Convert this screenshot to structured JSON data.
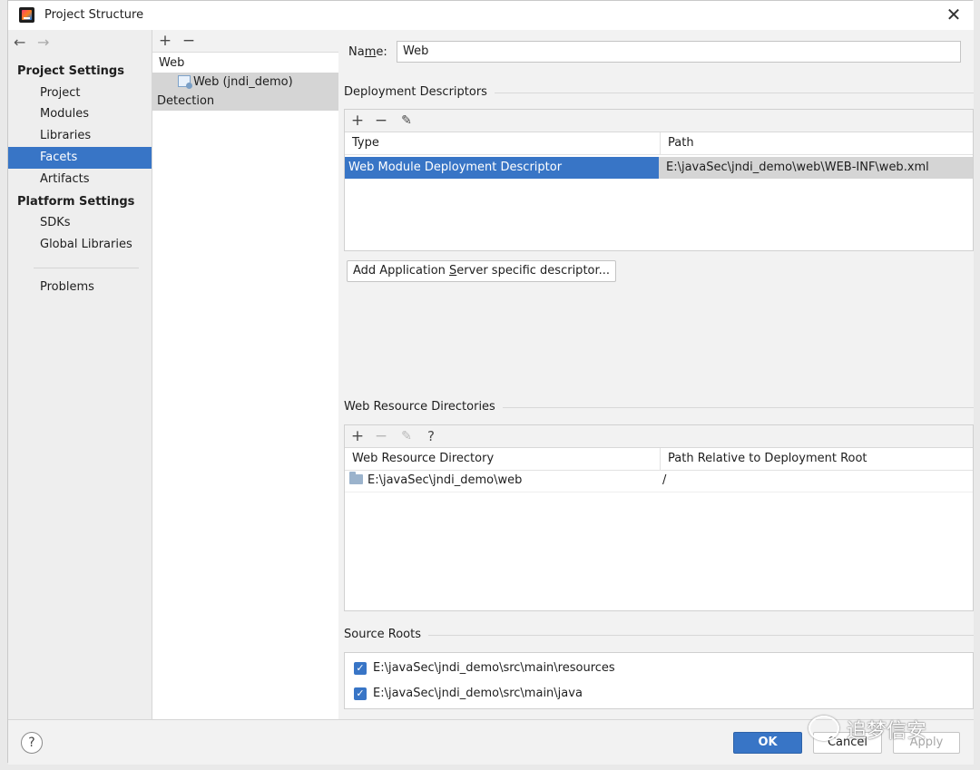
{
  "window": {
    "title": "Project Structure"
  },
  "nav": {
    "back": "←",
    "forward": "→",
    "project_settings": "Project Settings",
    "items_project": [
      "Project",
      "Modules",
      "Libraries",
      "Facets",
      "Artifacts"
    ],
    "platform_settings": "Platform Settings",
    "items_platform": [
      "SDKs",
      "Global Libraries"
    ],
    "problems": "Problems",
    "selected": "Facets"
  },
  "tree": {
    "add": "+",
    "remove": "−",
    "root": "Web",
    "child": "Web (jndi_demo)",
    "detection": "Detection"
  },
  "name": {
    "label_prefix": "Na",
    "label_mnemonic": "m",
    "label_suffix": "e:",
    "value": "Web"
  },
  "descriptors": {
    "title": "Deployment Descriptors",
    "col_type": "Type",
    "col_path": "Path",
    "rows": [
      {
        "type": "Web Module Deployment Descriptor",
        "path": "E:\\javaSec\\jndi_demo\\web\\WEB-INF\\web.xml"
      }
    ],
    "add_server_button_prefix": "Add Application ",
    "add_server_button_mnemonic": "S",
    "add_server_button_suffix": "erver specific descriptor..."
  },
  "resources": {
    "title": "Web Resource Directories",
    "help": "?",
    "col_dir": "Web Resource Directory",
    "col_rel": "Path Relative to Deployment Root",
    "rows": [
      {
        "dir": "E:\\javaSec\\jndi_demo\\web",
        "rel": "/"
      }
    ]
  },
  "sources": {
    "title": "Source Roots",
    "rows": [
      {
        "path": "E:\\javaSec\\jndi_demo\\src\\main\\resources",
        "checked": true
      },
      {
        "path": "E:\\javaSec\\jndi_demo\\src\\main\\java",
        "checked": true
      }
    ]
  },
  "footer": {
    "help": "?",
    "ok": "OK",
    "cancel": "Cancel",
    "apply": "Apply"
  },
  "watermark": "追梦信安",
  "colors": {
    "accent": "#3875c6",
    "selection_gray": "#d5d5d5"
  }
}
